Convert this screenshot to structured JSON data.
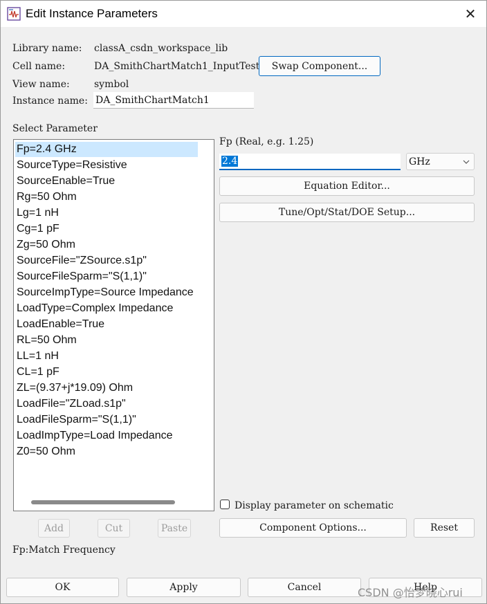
{
  "window": {
    "title": "Edit Instance Parameters",
    "close_glyph": "✕"
  },
  "info": {
    "library_label": "Library name:",
    "library_value": "classA_csdn_workspace_lib",
    "cell_label": "Cell name:",
    "cell_value": "DA_SmithChartMatch1_InputTest",
    "view_label": "View name:",
    "view_value": "symbol",
    "instance_label": "Instance name:",
    "instance_value": "DA_SmithChartMatch1",
    "swap_button": "Swap Component..."
  },
  "parameters": {
    "section_label": "Select Parameter",
    "selected_index": 0,
    "items": [
      "Fp=2.4 GHz",
      "SourceType=Resistive",
      "SourceEnable=True",
      "Rg=50 Ohm",
      "Lg=1 nH",
      "Cg=1 pF",
      "Zg=50 Ohm",
      "SourceFile=\"ZSource.s1p\"",
      "SourceFileSparm=\"S(1,1)\"",
      "SourceImpType=Source Impedance",
      "LoadType=Complex Impedance",
      "LoadEnable=True",
      "RL=50 Ohm",
      "LL=1 nH",
      "CL=1 pF",
      "ZL=(9.37+j*19.09) Ohm",
      "LoadFile=\"ZLoad.s1p\"",
      "LoadFileSparm=\"S(1,1)\"",
      "LoadImpType=Load Impedance",
      "Z0=50 Ohm"
    ],
    "add_button": "Add",
    "cut_button": "Cut",
    "paste_button": "Paste",
    "description": "Fp:Match Frequency"
  },
  "editor": {
    "param_label": "Fp (Real, e.g. 1.25)",
    "value": "2.4",
    "unit": "GHz",
    "equation_button": "Equation Editor...",
    "tune_button": "Tune/Opt/Stat/DOE Setup...",
    "display_checkbox_label": "Display parameter on schematic",
    "display_checked": false,
    "component_options_button": "Component Options...",
    "reset_button": "Reset"
  },
  "footer": {
    "ok_button": "OK",
    "apply_button": "Apply",
    "cancel_button": "Cancel",
    "help_button": "Help",
    "watermark": "CSDN @怡梦晓心rui"
  },
  "colors": {
    "selection": "#cce8ff",
    "accent": "#0067c0"
  }
}
